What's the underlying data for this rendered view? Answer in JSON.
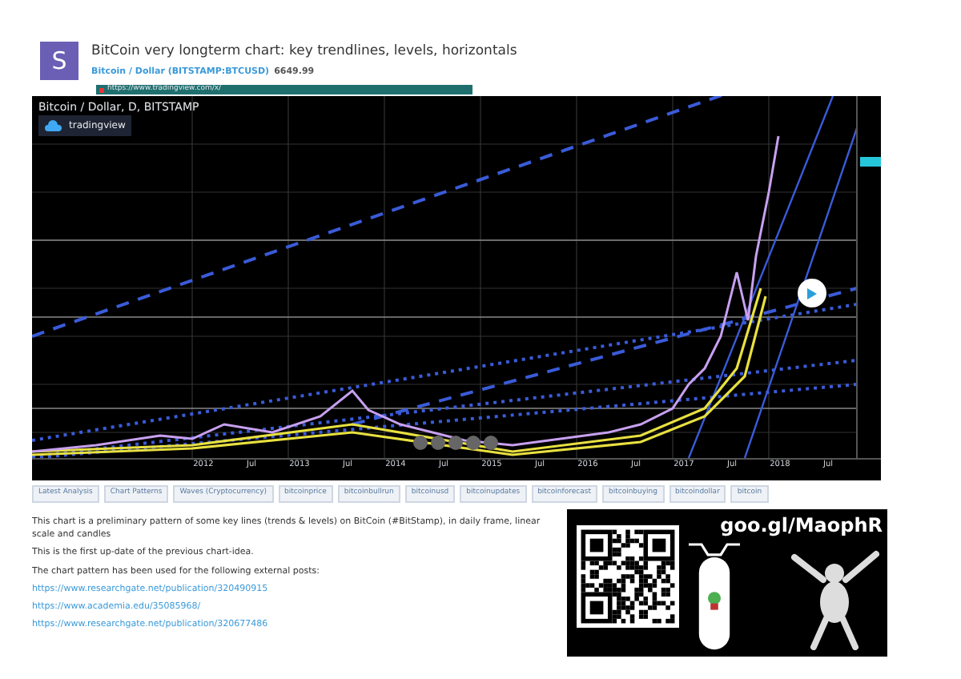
{
  "post": {
    "avatar_letter": "S",
    "title": "BitCoin very longterm chart: key trendlines, levels, horizontals",
    "symbol": "Bitcoin / Dollar (BITSTAMP:BTCUSD)",
    "price": "6649.99"
  },
  "url_bar": {
    "url": "https://www.tradingview.com/x/"
  },
  "chart": {
    "legend": "Bitcoin / Dollar, D, BITSTAMP",
    "logo_text": "tradingview",
    "x_labels": [
      "2012",
      "Jul",
      "2013",
      "Jul",
      "2014",
      "Jul",
      "2015",
      "Jul",
      "2016",
      "Jul",
      "2017",
      "Jul",
      "2018",
      "Jul"
    ]
  },
  "tags": [
    "Latest Analysis",
    "Chart Patterns",
    "Waves (Cryptocurrency)",
    "bitcoinprice",
    "bitcoinbullrun",
    "bitcoinusd",
    "bitcoinupdates",
    "bitcoinforecast",
    "bitcoinbuying",
    "bitcoindollar",
    "bitcoin"
  ],
  "description": {
    "lines": [
      "This chart is a preliminary pattern of some key lines (trends & levels) on BitCoin (#BitStamp), in daily frame, linear scale and candles",
      "This is the first up-date of the previous chart-idea.",
      "The chart pattern has been used for the following external posts:"
    ],
    "links": [
      "https://www.researchgate.net/publication/320490915",
      "https://www.academia.edu/35085968/",
      "https://www.researchgate.net/publication/320677486"
    ]
  },
  "promo": {
    "text": "goo.gl/MaophR"
  }
}
